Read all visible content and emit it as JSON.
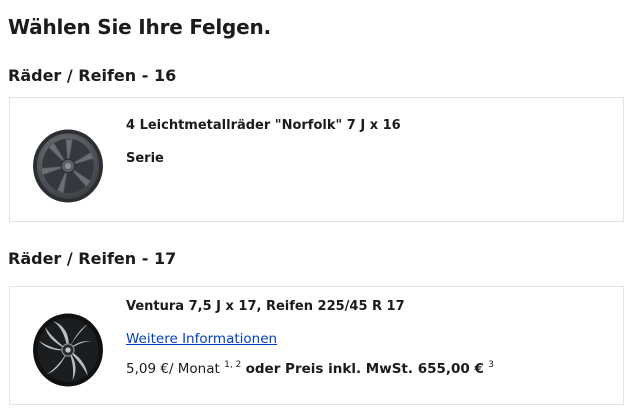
{
  "page": {
    "title": "Wählen Sie Ihre Felgen."
  },
  "sections": [
    {
      "title": "Räder / Reifen - 16",
      "option": {
        "name": "4 Leichtmetallräder \"Norfolk\" 7 J x 16",
        "status": "Serie",
        "image": "wheel-norfolk-image"
      }
    },
    {
      "title": "Räder / Reifen - 17",
      "option": {
        "name": "Ventura 7,5 J x 17, Reifen 225/45 R 17",
        "link": "Weitere Informationen",
        "monthly": "5,09 €/ Monat",
        "monthly_footnote": "1, 2",
        "price_label": "oder Preis inkl. MwSt. 655,00 €",
        "price_footnote": "3",
        "image": "wheel-ventura-image"
      }
    }
  ],
  "colors": {
    "link": "#0040c5",
    "border": "#dfe4e8",
    "text": "#1b1b1b"
  }
}
